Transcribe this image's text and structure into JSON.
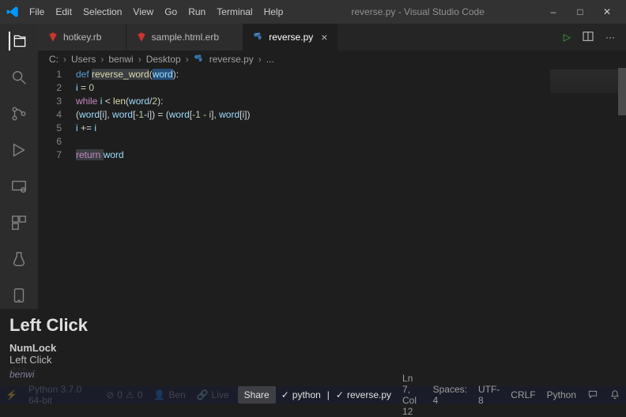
{
  "title_center": "reverse.py - Visual Studio Code",
  "menu": {
    "file": "File",
    "edit": "Edit",
    "selection": "Selection",
    "view": "View",
    "go": "Go",
    "run": "Run",
    "terminal": "Terminal",
    "help": "Help"
  },
  "tabs": {
    "t1": {
      "label": "hotkey.rb"
    },
    "t2": {
      "label": "sample.html.erb"
    },
    "t3": {
      "label": "reverse.py"
    }
  },
  "breadcrumbs": {
    "c1": "C:",
    "c2": "Users",
    "c3": "benwi",
    "c4": "Desktop",
    "c5": "reverse.py",
    "c6": "..."
  },
  "gutter": {
    "l1": "1",
    "l2": "2",
    "l3": "3",
    "l4": "4",
    "l5": "5",
    "l6": "6",
    "l7": "7"
  },
  "code": {
    "l1": {
      "a": "def ",
      "b": "reverse_word",
      "c": "(",
      "d": "word",
      "e": "):"
    },
    "l2": {
      "a": "i ",
      "b": "= ",
      "c": "0"
    },
    "l3": {
      "a": "while ",
      "b": "i ",
      "c": "< ",
      "d": "len",
      "e": "(",
      "f": "word",
      "g": "/",
      "h": "2",
      "i": "):"
    },
    "l4": {
      "a": "(",
      "b": "word",
      "c": "[",
      "d": "i",
      "e": "], ",
      "f": "word",
      "g": "[",
      "h": "-1",
      "i": "-",
      "j": "i",
      "k": "]) = (",
      "l": "word",
      "m": "[",
      "n": "-1 - i",
      "o": "], ",
      "p": "word",
      "q": "[",
      "r": "i",
      "s": "])"
    },
    "l5": {
      "a": "i ",
      "b": "+= ",
      "c": "i"
    },
    "l7": {
      "a": "return ",
      "b": "word"
    }
  },
  "overlay": {
    "big": "Left Click",
    "s1": "NumLock",
    "s2": "Left Click",
    "user": "benwi"
  },
  "status": {
    "pyenv": "Python 3.7.0 64-bit",
    "problems": "0",
    "warnings": "0",
    "ls_user": "Ben",
    "ls_label": "Live",
    "share": "Share",
    "python_chk": "python",
    "reverse_chk": "reverse.py",
    "pos": "Ln 7, Col 12",
    "spaces": "Spaces: 4",
    "encoding": "UTF-8",
    "eol": "CRLF",
    "lang": "Python"
  }
}
